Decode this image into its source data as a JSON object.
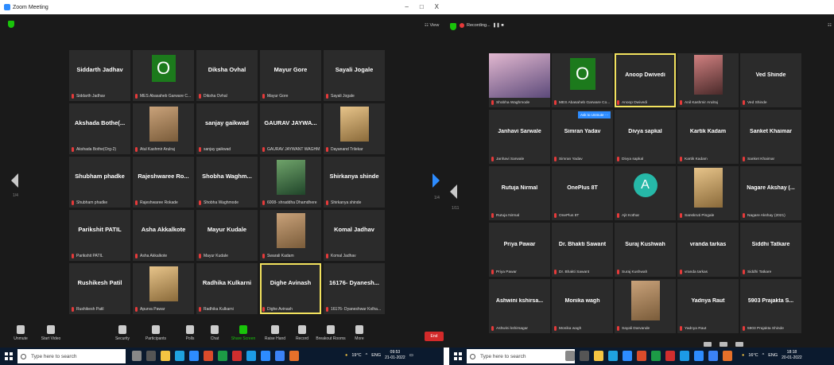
{
  "left_window": {
    "title": "Zoom Meeting",
    "controls": [
      "–",
      "□",
      "X"
    ],
    "page_label": "1/4",
    "view_label": "View",
    "tiles": [
      {
        "name": "Siddarth Jadhav",
        "label": "Siddarth Jadhav",
        "kind": "name"
      },
      {
        "name": "O",
        "label": "MES Abasaheb Garware C...",
        "kind": "initial-box"
      },
      {
        "name": "Diksha Ovhal",
        "label": "Diksha Ovhal",
        "kind": "name"
      },
      {
        "name": "Mayur Gore",
        "label": "Mayur Gore",
        "kind": "name"
      },
      {
        "name": "Sayali Jogale",
        "label": "Sayali Jogale",
        "kind": "name"
      },
      {
        "name": "Akshada Bothe(...",
        "label": "Akshada Bothe(Org-2)",
        "kind": "name"
      },
      {
        "name": "",
        "label": "Atul Kashmir Arulraj",
        "kind": "photo"
      },
      {
        "name": "sanjay gaikwad",
        "label": "sanjay gaikwad",
        "kind": "name"
      },
      {
        "name": "GAURAV JAYWA...",
        "label": "GAURAV JAYWANT WAGHMAR...",
        "kind": "name"
      },
      {
        "name": "",
        "label": "Dayanand Trilekar",
        "kind": "photo"
      },
      {
        "name": "Shubham phadke",
        "label": "Shubham phadke",
        "kind": "name"
      },
      {
        "name": "Rajeshwaree Ro...",
        "label": "Rajeshwaree Rokade",
        "kind": "name"
      },
      {
        "name": "Shobha Waghm...",
        "label": "Shobha Waghmode",
        "kind": "name"
      },
      {
        "name": "",
        "label": "6008- shraddha Dhamdhere",
        "kind": "photo"
      },
      {
        "name": "Shirkanya shinde",
        "label": "Shirkanya shinde",
        "kind": "name"
      },
      {
        "name": "Parikshit PATIL",
        "label": "Parikshit PATIL",
        "kind": "name"
      },
      {
        "name": "Asha Akkalkote",
        "label": "Asha Akkalkote",
        "kind": "name"
      },
      {
        "name": "Mayur Kudale",
        "label": "Mayur Kudale",
        "kind": "name"
      },
      {
        "name": "",
        "label": "Swarali Kadam",
        "kind": "photo"
      },
      {
        "name": "Komal Jadhav",
        "label": "Komal Jadhav",
        "kind": "name"
      },
      {
        "name": "Rushikesh Patil",
        "label": "Rushikesh Patil",
        "kind": "name"
      },
      {
        "name": "",
        "label": "Apurva Pawar",
        "kind": "photo"
      },
      {
        "name": "Radhika Kulkarni",
        "label": "Radhika Kulkarni",
        "kind": "name"
      },
      {
        "name": "Dighe Avinash",
        "label": "Dighe Avinash",
        "kind": "name",
        "speaker": true
      },
      {
        "name": "16176- Dyanesh...",
        "label": "16176- Dyaneshwar Kolha...",
        "kind": "name"
      }
    ],
    "toolbar": {
      "unmute": "Unmute",
      "start_video": "Start Video",
      "security": "Security",
      "participants": "Participants",
      "participants_count": "88",
      "polls": "Polls",
      "chat": "Chat",
      "share_screen": "Share Screen",
      "raise_hand": "Raise Hand",
      "record": "Record",
      "breakout_rooms": "Breakout Rooms",
      "more": "More",
      "end": "End"
    },
    "taskbar": {
      "search_placeholder": "Type here to search",
      "temperature": "19°C",
      "language": "ENG",
      "time": "09:53",
      "date": "21-01-2022"
    }
  },
  "right_window": {
    "recording_label": "Recording...",
    "page_label_a": "1/4",
    "page_label_b": "1/11",
    "unmute_prompt": "Ask to Unmute",
    "tiles": [
      {
        "name": "",
        "label": "Shobha Waghmode",
        "kind": "wide-photo"
      },
      {
        "name": "O",
        "label": "MES Abasaheb Garware Co...",
        "kind": "initial-box"
      },
      {
        "name": "Anoop Dwivedi",
        "label": "Anoop Dwivedi",
        "kind": "name",
        "speaker": true
      },
      {
        "name": "",
        "label": "Anil Kashmir Arulraj",
        "kind": "photo"
      },
      {
        "name": "Ved Shinde",
        "label": "Ved Shinde",
        "kind": "name"
      },
      {
        "name": "Janhavi Sarwale",
        "label": "Janhavi Sarwale",
        "kind": "name"
      },
      {
        "name": "Simran Yadav",
        "label": "Simran Yadav",
        "kind": "name"
      },
      {
        "name": "Divya sapkal",
        "label": "Divya sapkal",
        "kind": "name"
      },
      {
        "name": "Kartik Kadam",
        "label": "Kartik Kadam",
        "kind": "name"
      },
      {
        "name": "Sanket Khaimar",
        "label": "Sanket Khaimar",
        "kind": "name"
      },
      {
        "name": "Rutuja Nirmal",
        "label": "Rutuja Nirmal",
        "kind": "name"
      },
      {
        "name": "OnePlus 8T",
        "label": "OnePlus 8T",
        "kind": "name"
      },
      {
        "name": "A",
        "label": "Ajit Kothar",
        "kind": "initial-circle"
      },
      {
        "name": "",
        "label": "Sanskruti Pingale",
        "kind": "photo"
      },
      {
        "name": "Nagare Akshay (...",
        "label": "Nagare Akshay (2021)",
        "kind": "name"
      },
      {
        "name": "Priya Pawar",
        "label": "Priya Pawar",
        "kind": "name"
      },
      {
        "name": "Dr. Bhakti Sawant",
        "label": "Dr. Bhakti Sawant",
        "kind": "name"
      },
      {
        "name": "Suraj Kushwah",
        "label": "Suraj Kushwah",
        "kind": "name"
      },
      {
        "name": "vranda tarkas",
        "label": "vranda tarkas",
        "kind": "name"
      },
      {
        "name": "Siddhi Tatkare",
        "label": "Siddhi Tatkare",
        "kind": "name"
      },
      {
        "name": "Ashwini kshirsa...",
        "label": "Ashwini kshirsagar",
        "kind": "name"
      },
      {
        "name": "Monika wagh",
        "label": "Monika wagh",
        "kind": "name"
      },
      {
        "name": "",
        "label": "Sayali Darvande",
        "kind": "photo"
      },
      {
        "name": "Yadnya Raut",
        "label": "Yadnya Raut",
        "kind": "name"
      },
      {
        "name": "5903 Prajakta S...",
        "label": "5903 Prajakta Shinde",
        "kind": "name"
      }
    ],
    "taskbar": {
      "search_placeholder": "Type here to search",
      "temperature": "16°C",
      "language": "ENG",
      "time": "18:18",
      "date": "20-01-2022"
    }
  },
  "colors": {
    "meeting_bg": "#1a1a1a",
    "tile_bg": "#2b2b2b",
    "speaker_outline": "#f2e25e",
    "muted_mic": "#e63a3a",
    "zoom_blue": "#2d8cff",
    "share_green": "#19c40a",
    "end_red": "#d32a2a",
    "taskbar_bg": "#0b1a2e"
  }
}
